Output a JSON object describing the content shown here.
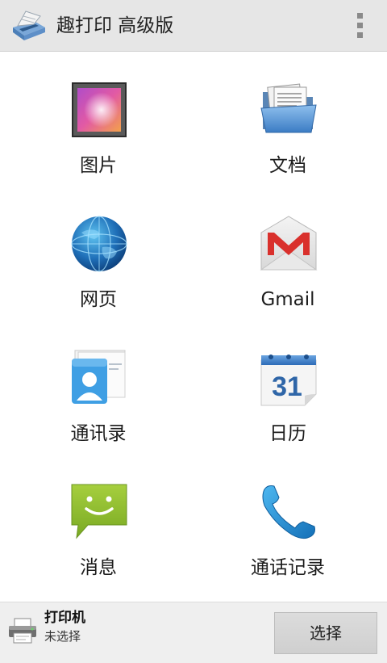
{
  "header": {
    "title": "趣打印 高级版",
    "logo_icon": "printer-logo-icon",
    "menu_icon": "overflow-menu-icon"
  },
  "grid": {
    "items": [
      {
        "label": "图片",
        "icon": "gallery-icon"
      },
      {
        "label": "文档",
        "icon": "folder-documents-icon"
      },
      {
        "label": "网页",
        "icon": "globe-icon"
      },
      {
        "label": "Gmail",
        "icon": "gmail-icon"
      },
      {
        "label": "通讯录",
        "icon": "contacts-icon"
      },
      {
        "label": "日历",
        "icon": "calendar-icon",
        "day": "31"
      },
      {
        "label": "消息",
        "icon": "message-icon"
      },
      {
        "label": "通话记录",
        "icon": "phone-icon"
      }
    ]
  },
  "footer": {
    "printer_title": "打印机",
    "printer_status": "未选择",
    "select_label": "选择",
    "printer_icon": "printer-icon"
  },
  "colors": {
    "action_bar_bg": "#e6e6e6",
    "bottom_bar_bg": "#efefef",
    "gmail_red": "#d9302c",
    "message_green": "#8fbf2c",
    "phone_blue": "#1c8fd6"
  }
}
